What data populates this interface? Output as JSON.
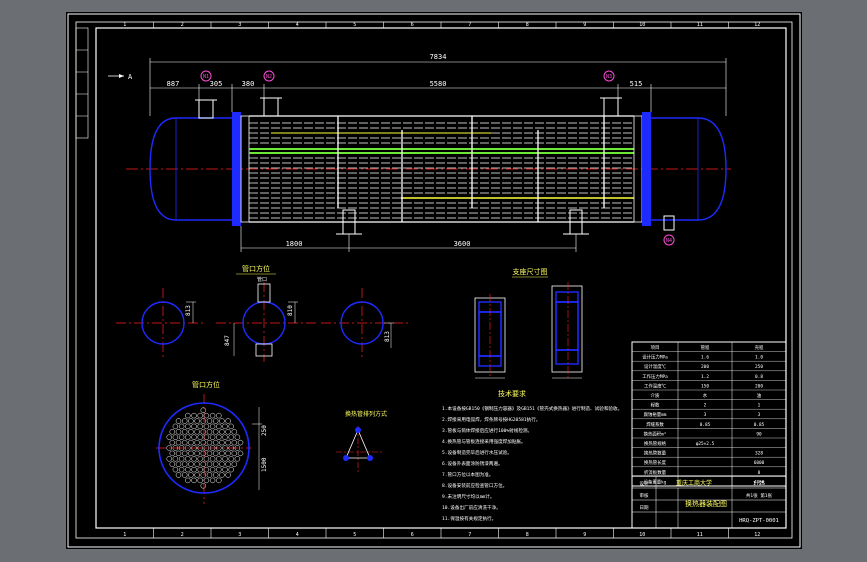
{
  "colors": {
    "paper": "#000000",
    "frame": "#ffffff",
    "dimension": "#ffffff",
    "outline": "#1e2bff",
    "center_line": "#ff2020",
    "tube": "#ffffff",
    "highlight_green": "#6ee636",
    "highlight_yellow": "#ffff3c",
    "nozzle_tag": "#ff4cd8",
    "title_text": "#ffff60",
    "window_bg": "#6b6e73"
  },
  "border": {
    "top_zone_numbers": [
      "1",
      "2",
      "3",
      "4",
      "5",
      "6",
      "7",
      "8",
      "9",
      "10",
      "11",
      "12"
    ],
    "bottom_zone_numbers": [
      "1",
      "2",
      "3",
      "4",
      "5",
      "6",
      "7",
      "8",
      "9",
      "10",
      "11",
      "12"
    ]
  },
  "main_view": {
    "overall_length": "7834",
    "top_dims": [
      "887",
      "305",
      "380",
      "5580",
      "515"
    ],
    "bottom_dims": [
      "1800",
      "3600"
    ],
    "section_marker": "A",
    "nozzle_tags": [
      {
        "id": "n1",
        "label": "N1"
      },
      {
        "id": "n2",
        "label": "N2"
      },
      {
        "id": "n3",
        "label": "N3"
      },
      {
        "id": "n4",
        "label": "N4"
      }
    ]
  },
  "details": {
    "nozzle_view_title": "管口方位",
    "nozzle_sub_label": "管口",
    "dim_a": "813",
    "dim_b": "810",
    "dim_c": "813",
    "dim_d": "847",
    "support_title": "支座尺寸图",
    "tubesheet_title": "管口方位",
    "tube_layout_title": "换热管排列方式",
    "tubesheet_dims": [
      "250",
      "1500"
    ]
  },
  "notes": {
    "title": "技术要求",
    "lines": [
      "1.本设备按GB150《钢制压力容器》及GB151《管壳式换热器》进行制造、试验和验收。",
      "2.焊接采用电弧焊，焊条牌号按HG20581执行。",
      "3.管板与筒体焊接后应进行100%射线检测。",
      "4.换热管与管板连接采用强度焊加贴胀。",
      "5.设备制造完毕后进行水压试验。",
      "6.设备外表面涂防锈漆两遍。",
      "7.管口方位以本图为准。",
      "8.设备安装前应检查管口方位。",
      "9.未注明尺寸均以mm计。",
      "10.设备出厂前应清洗干净。",
      "11.保温按有关规定执行。"
    ]
  },
  "spec_table": {
    "headers": [
      "项目",
      "管程",
      "壳程"
    ],
    "rows": [
      [
        "设计压力MPa",
        "1.6",
        "1.0"
      ],
      [
        "设计温度℃",
        "200",
        "250"
      ],
      [
        "工作压力MPa",
        "1.2",
        "0.8"
      ],
      [
        "工作温度℃",
        "150",
        "200"
      ],
      [
        "介质",
        "水",
        "油"
      ],
      [
        "程数",
        "2",
        "1"
      ],
      [
        "腐蚀裕量mm",
        "3",
        "3"
      ],
      [
        "焊缝系数",
        "0.85",
        "0.85"
      ],
      [
        "换热面积m²",
        "",
        "90"
      ],
      [
        "换热管规格",
        "φ25×2.5",
        ""
      ],
      [
        "换热管数量",
        "",
        "328"
      ],
      [
        "换热管长度",
        "",
        "6000"
      ],
      [
        "折流板数量",
        "",
        "8"
      ],
      [
        "设备重量kg",
        "",
        "4800"
      ]
    ]
  },
  "title_block": {
    "school": "重庆工商大学",
    "drawing_name": "换热器装配图",
    "scale": "1:25",
    "sheet": "共1张 第1张",
    "drawing_no": "HRQ-ZPT-0001",
    "label_design": "设计",
    "label_check": "审核",
    "label_date": "日期"
  }
}
